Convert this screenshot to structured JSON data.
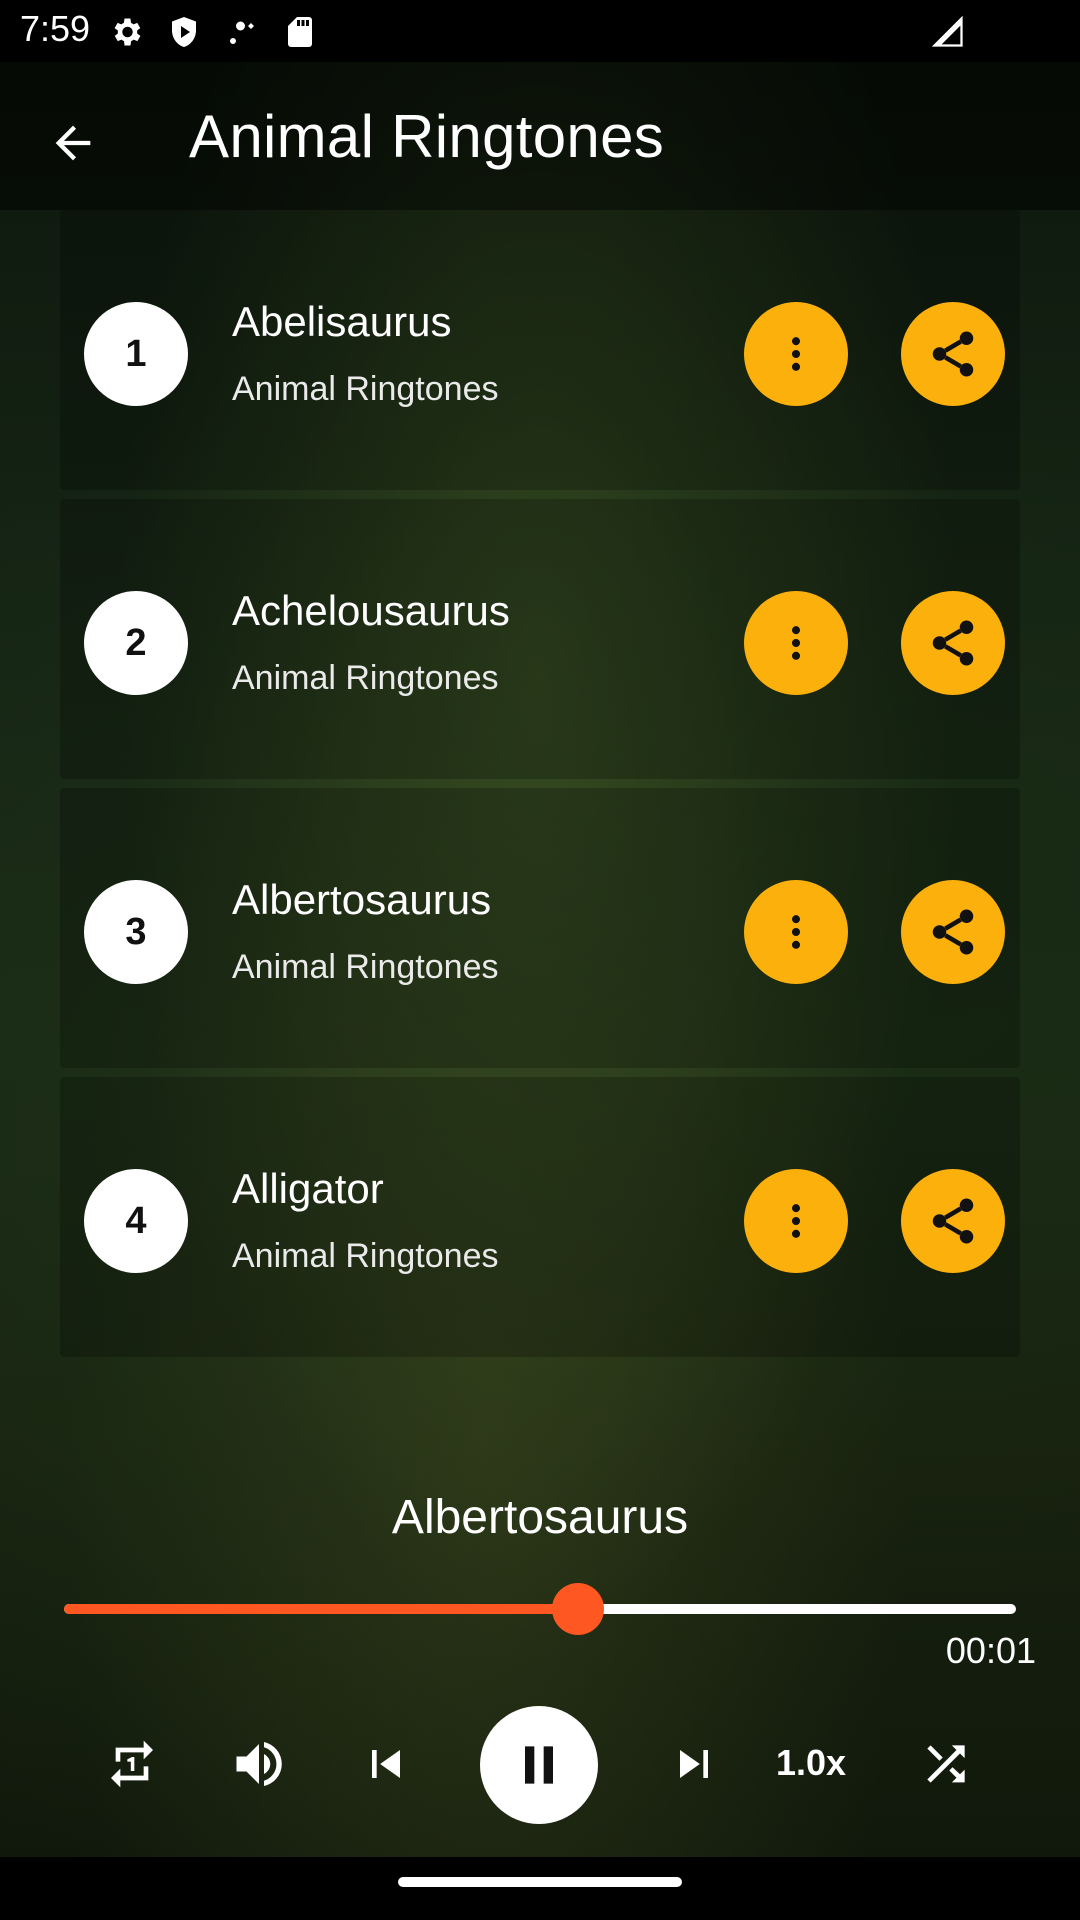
{
  "status_bar": {
    "time": "7:59",
    "icons": [
      "gear-icon",
      "shield-play-icon",
      "wifi-gear-icon",
      "sd-card-icon",
      "signal-icon"
    ]
  },
  "app_bar": {
    "title": "Animal Ringtones",
    "back_icon": "arrow-back-icon"
  },
  "list": {
    "items": [
      {
        "number": "1",
        "title": "Abelisaurus",
        "subtitle": "Animal Ringtones"
      },
      {
        "number": "2",
        "title": "Achelousaurus",
        "subtitle": "Animal Ringtones"
      },
      {
        "number": "3",
        "title": "Albertosaurus",
        "subtitle": "Animal Ringtones"
      },
      {
        "number": "4",
        "title": "Alligator",
        "subtitle": "Animal Ringtones"
      }
    ],
    "accent_color": "#fbb00b"
  },
  "player": {
    "now_playing": "Albertosaurus",
    "elapsed": "00:01",
    "progress_fraction": 0.54,
    "progress_color": "#ff5722",
    "speed": "1.0x",
    "state": "playing",
    "controls": [
      "repeat-one-icon",
      "volume-icon",
      "skip-previous-icon",
      "pause-icon",
      "skip-next-icon",
      "speed",
      "shuffle-icon"
    ]
  }
}
